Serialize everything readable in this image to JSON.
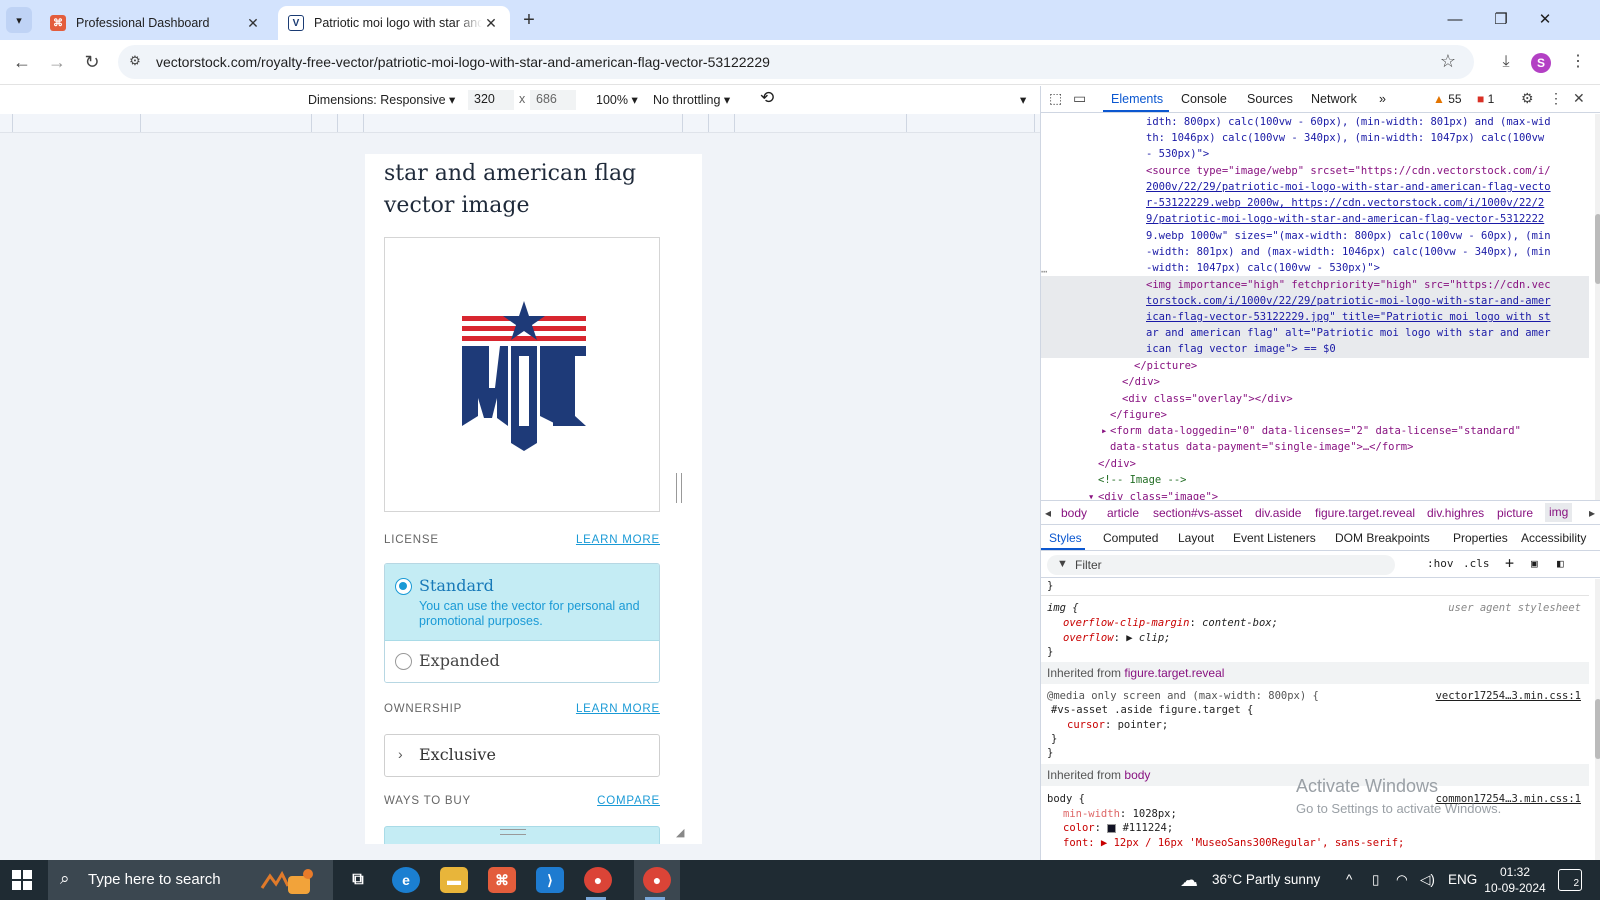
{
  "browser": {
    "tabs": [
      {
        "title": "Professional Dashboard"
      },
      {
        "title": "Patriotic moi logo with star and american flag"
      }
    ],
    "url": "vectorstock.com/royalty-free-vector/patriotic-moi-logo-with-star-and-american-flag-vector-53122229",
    "profile_initial": "S"
  },
  "device_toolbar": {
    "dimensions_label": "Dimensions: Responsive",
    "width": "320",
    "height": "686",
    "times": "x",
    "zoom": "100%",
    "throttling": "No throttling"
  },
  "page": {
    "heading": "star and american flag vector image",
    "logo_text": "MOI",
    "license": {
      "label": "LICENSE",
      "learn_more": "LEARN MORE",
      "options": [
        {
          "name": "Standard",
          "description": "You can use the vector for personal and promotional purposes.",
          "selected": true
        },
        {
          "name": "Expanded",
          "selected": false
        }
      ]
    },
    "ownership": {
      "label": "OWNERSHIP",
      "learn_more": "LEARN MORE",
      "option": "Exclusive"
    },
    "ways_to_buy": {
      "label": "WAYS TO BUY",
      "compare": "COMPARE"
    }
  },
  "devtools": {
    "tabs": [
      "Elements",
      "Console",
      "Sources",
      "Network"
    ],
    "active_tab": "Elements",
    "more": "»",
    "warnings": "55",
    "errors": "1",
    "code_lines": [
      {
        "text": "idth: 800px) calc(100vw - 60px), (min-width: 801px) and (max-wid"
      },
      {
        "text": "th: 1046px) calc(100vw - 340px), (min-width: 1047px) calc(100vw"
      },
      {
        "text": "- 530px)\">"
      },
      {
        "text": "<source type=\"image/webp\" srcset=\"https://cdn.vectorstock.com/i/"
      },
      {
        "text": "2000v/22/29/patriotic-moi-logo-with-star-and-american-flag-vecto"
      },
      {
        "text": "r-53122229.webp 2000w, https://cdn.vectorstock.com/i/1000v/22/2"
      },
      {
        "text": "9/patriotic-moi-logo-with-star-and-american-flag-vector-5312222"
      },
      {
        "text": "9.webp 1000w\" sizes=\"(max-width: 800px) calc(100vw - 60px), (min"
      },
      {
        "text": "-width: 801px) and (max-width: 1046px) calc(100vw - 340px), (min"
      },
      {
        "text": "-width: 1047px) calc(100vw - 530px)\">"
      },
      {
        "text": "<img importance=\"high\" fetchpriority=\"high\" src=\"https://cdn.vec"
      },
      {
        "text": "torstock.com/i/1000v/22/29/patriotic-moi-logo-with-star-and-amer"
      },
      {
        "text": "ican-flag-vector-53122229.jpg\" title=\"Patriotic moi logo with st"
      },
      {
        "text": "ar and american flag\" alt=\"Patriotic moi logo with star and amer"
      },
      {
        "text": "ican flag vector image\"> == $0"
      },
      {
        "text": "</picture>"
      },
      {
        "text": "</div>"
      },
      {
        "text": "<div class=\"overlay\"></div>"
      },
      {
        "text": "</figure>"
      },
      {
        "text": "<form data-loggedin=\"0\" data-licenses=\"2\" data-license=\"standard\""
      },
      {
        "text": "data-status data-payment=\"single-image\">…</form>"
      },
      {
        "text": "</div>"
      },
      {
        "text": "<!-- Image -->"
      },
      {
        "text": "<div class=\"image\">"
      }
    ],
    "breadcrumbs": [
      "body",
      "article",
      "section#vs-asset",
      "div.aside",
      "figure.target.reveal",
      "div.highres",
      "picture",
      "img"
    ],
    "subtabs": [
      "Styles",
      "Computed",
      "Layout",
      "Event Listeners",
      "DOM Breakpoints",
      "Properties",
      "Accessibility"
    ],
    "filter_placeholder": "Filter",
    "filter_hov": ":hov",
    "filter_cls": ".cls",
    "styles": {
      "img_selector": "img {",
      "ua_label": "user agent stylesheet",
      "overflow_clip_prop": "overflow-clip-margin",
      "overflow_clip_val": "content-box;",
      "overflow_prop": "overflow",
      "overflow_val": "clip;",
      "close_brace": "}",
      "inherited_1_prefix": "Inherited from",
      "inherited_1_sel": "figure.target.reveal",
      "media_query": "@media only screen and (max-width: 800px) {",
      "media_src": "vector17254…3.min.css:1",
      "media_selector": "#vs-asset .aside figure.target {",
      "cursor_prop": "cursor",
      "cursor_val": "pointer;",
      "inherited_2_prefix": "Inherited from",
      "inherited_2_sel": "body",
      "body_selector": "body {",
      "body_src": "common17254…3.min.css:1",
      "minwidth_prop": "min-width",
      "minwidth_val": "1028px;",
      "color_prop": "color",
      "color_val": "#111224;",
      "font_line": "font: ▶ 12px / 16px 'MuseoSans300Regular', sans-serif;"
    }
  },
  "watermark": {
    "title": "Activate Windows",
    "subtitle": "Go to Settings to activate Windows."
  },
  "taskbar": {
    "search_placeholder": "Type here to search",
    "weather": "36°C  Partly sunny",
    "language": "ENG",
    "time": "01:32",
    "date": "10-09-2024",
    "notifications": "2"
  }
}
